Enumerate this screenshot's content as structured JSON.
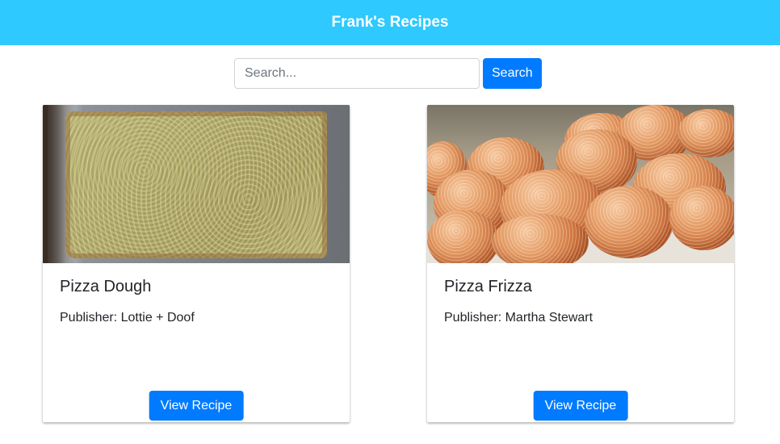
{
  "header": {
    "title": "Frank's Recipes"
  },
  "search": {
    "placeholder": "Search...",
    "value": "",
    "button_label": "Search"
  },
  "recipes": [
    {
      "title": "Pizza Dough",
      "publisher": "Publisher: Lottie + Doof",
      "button_label": "View Recipe",
      "image_icon": "pizza-dough-photo"
    },
    {
      "title": "Pizza Frizza",
      "publisher": "Publisher: Martha Stewart",
      "button_label": "View Recipe",
      "image_icon": "fried-dough-balls-photo"
    }
  ],
  "colors": {
    "header_bg": "#2ec9ff",
    "primary": "#007bff"
  }
}
